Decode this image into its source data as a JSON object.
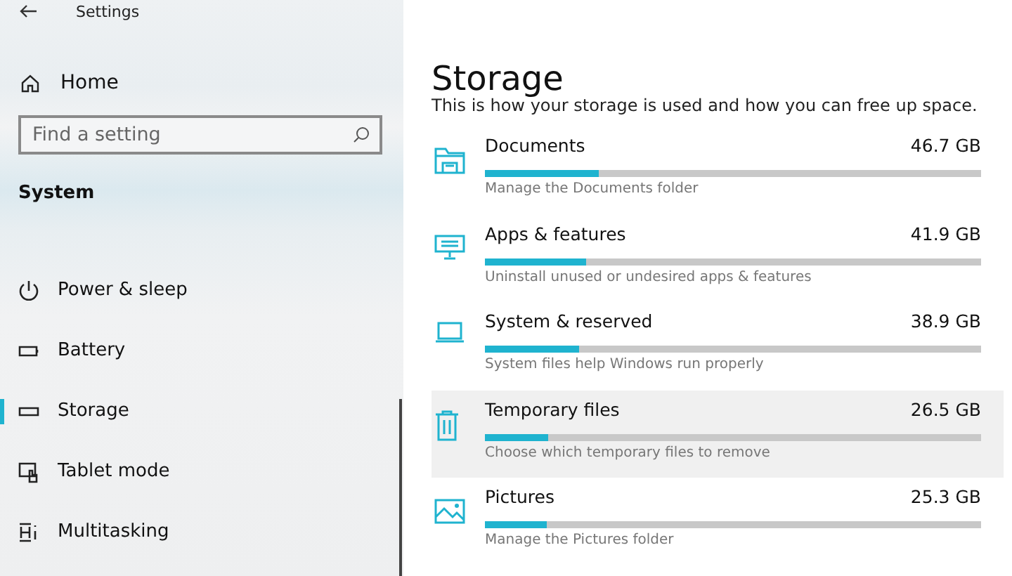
{
  "window": {
    "title": "Settings"
  },
  "sidebar": {
    "home": "Home",
    "search": {
      "placeholder": "Find a setting"
    },
    "section": "System",
    "items": [
      {
        "label": "Power & sleep",
        "selected": false
      },
      {
        "label": "Battery",
        "selected": false
      },
      {
        "label": "Storage",
        "selected": true
      },
      {
        "label": "Tablet mode",
        "selected": false
      },
      {
        "label": "Multitasking",
        "selected": false
      }
    ]
  },
  "main": {
    "title": "Storage",
    "subtitle": "This is how your storage is used and how you can free up space.",
    "categories": [
      {
        "name": "Documents",
        "size": "46.7 GB",
        "description": "Manage the Documents folder",
        "level": 0.23,
        "highlighted": false
      },
      {
        "name": "Apps & features",
        "size": "41.9 GB",
        "description": "Uninstall unused or undesired apps & features",
        "level": 0.205,
        "highlighted": false
      },
      {
        "name": "System & reserved",
        "size": "38.9 GB",
        "description": "System files help Windows run properly",
        "level": 0.19,
        "highlighted": false
      },
      {
        "name": "Temporary files",
        "size": "26.5 GB",
        "description": "Choose which temporary files to remove",
        "level": 0.128,
        "highlighted": true
      },
      {
        "name": "Pictures",
        "size": "25.3 GB",
        "description": "Manage the Pictures folder",
        "level": 0.125,
        "highlighted": false
      }
    ]
  }
}
